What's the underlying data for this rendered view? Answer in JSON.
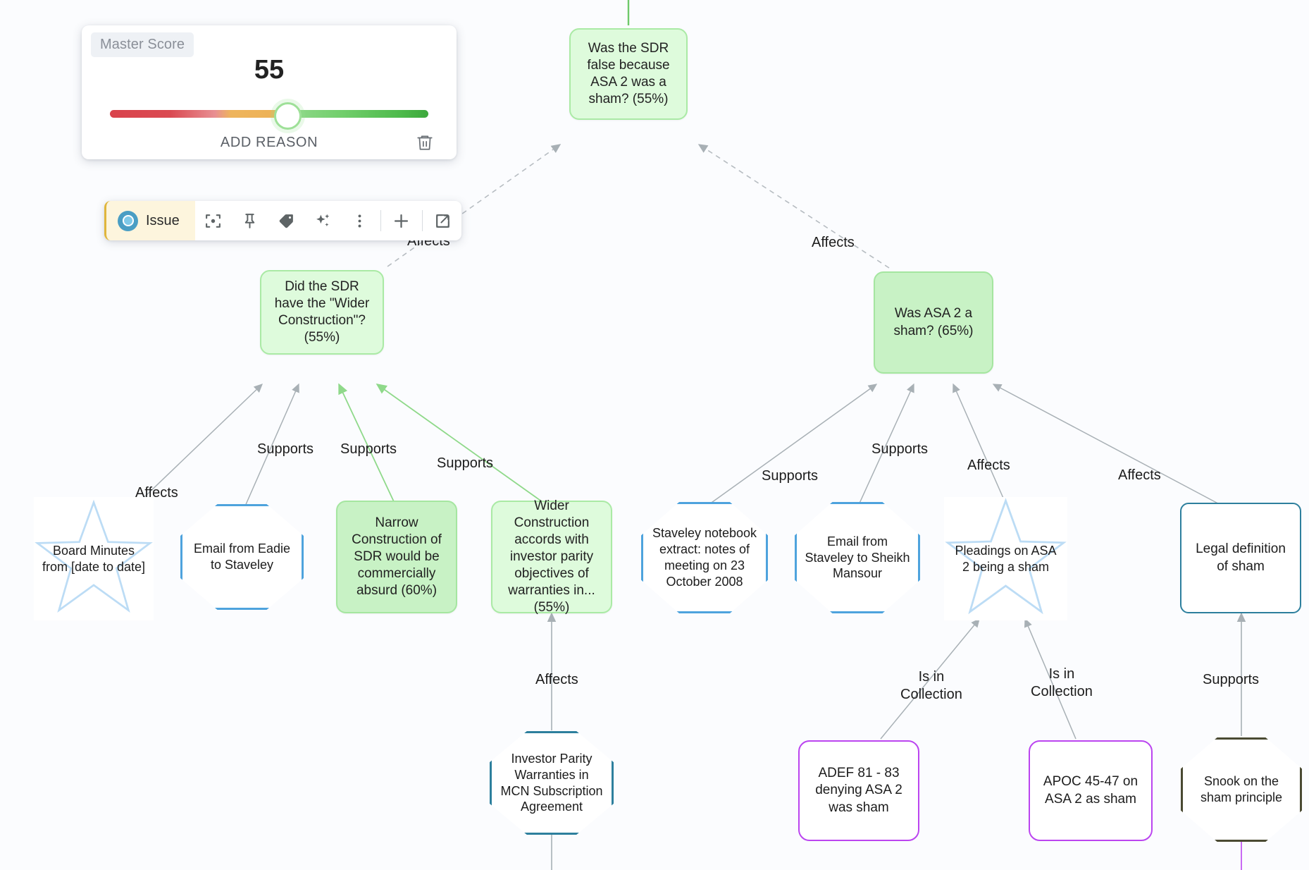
{
  "score_panel": {
    "chip_label": "Master Score",
    "value": "55",
    "add_reason_label": "ADD REASON",
    "slider_percent": 55,
    "trash_icon": "trash-icon",
    "colors": {
      "low": "#d9434c",
      "mid": "#eeb45c",
      "high": "#3da83c",
      "thumb_ring": "#9ee098"
    }
  },
  "toolbar": {
    "type_label": "Issue",
    "buttons": [
      {
        "name": "focus-target-icon",
        "title": "focus"
      },
      {
        "name": "pin-icon",
        "title": "pin"
      },
      {
        "name": "tag-icon",
        "title": "tag"
      },
      {
        "name": "sparkles-icon",
        "title": "ai"
      },
      {
        "name": "more-options-icon",
        "title": "more"
      },
      {
        "name": "plus-icon",
        "title": "add"
      },
      {
        "name": "open-external-icon",
        "title": "open"
      }
    ]
  },
  "graph": {
    "nodes": [
      {
        "id": "n1",
        "label": "Was the SDR false because ASA 2 was a sham? (55%)",
        "shape": "rounded-rect",
        "kind": "issue",
        "score": "55%"
      },
      {
        "id": "n2",
        "label": "Did the SDR have the \"Wider Construction\"? (55%)",
        "shape": "rounded-rect",
        "kind": "issue",
        "score": "55%"
      },
      {
        "id": "n3",
        "label": "Was ASA 2 a sham? (65%)",
        "shape": "rounded-rect",
        "kind": "issue",
        "score": "65%"
      },
      {
        "id": "n4",
        "label": "Board Minutes from [date to date]",
        "shape": "star",
        "kind": "collection"
      },
      {
        "id": "n5",
        "label": "Email from Eadie to Staveley",
        "shape": "octagon",
        "kind": "evidence"
      },
      {
        "id": "n6",
        "label": "Narrow Construction of SDR would be commercially absurd (60%)",
        "shape": "rounded-rect",
        "kind": "claim",
        "score": "60%"
      },
      {
        "id": "n7",
        "label": "Wider Construction accords with investor parity objectives of warranties in... (55%)",
        "shape": "rounded-rect",
        "kind": "claim",
        "score": "55%"
      },
      {
        "id": "n8",
        "label": "Staveley notebook extract: notes of meeting on 23 October 2008",
        "shape": "octagon",
        "kind": "evidence"
      },
      {
        "id": "n9",
        "label": "Email from Staveley to Sheikh Mansour",
        "shape": "octagon",
        "kind": "evidence"
      },
      {
        "id": "n10",
        "label": "Pleadings on ASA 2 being a sham",
        "shape": "star",
        "kind": "collection"
      },
      {
        "id": "n11",
        "label": "Legal definition of sham",
        "shape": "rounded-rect",
        "kind": "authority"
      },
      {
        "id": "n12",
        "label": "Investor Parity Warranties in MCN Subscription Agreement",
        "shape": "octagon",
        "kind": "evidence"
      },
      {
        "id": "n13",
        "label": "ADEF 81 - 83 denying ASA 2 was sham",
        "shape": "rounded-rect",
        "kind": "pleading"
      },
      {
        "id": "n14",
        "label": "APOC 45-47 on ASA 2 as sham",
        "shape": "rounded-rect",
        "kind": "pleading"
      },
      {
        "id": "n15",
        "label": "Snook on the sham principle",
        "shape": "octagon",
        "kind": "authority"
      }
    ],
    "edge_labels": [
      {
        "id": "e1",
        "text": "Affects"
      },
      {
        "id": "e2",
        "text": "Affects"
      },
      {
        "id": "e3",
        "text": "Affects"
      },
      {
        "id": "e4",
        "text": "Supports"
      },
      {
        "id": "e5",
        "text": "Supports"
      },
      {
        "id": "e6",
        "text": "Supports"
      },
      {
        "id": "e7",
        "text": "Supports"
      },
      {
        "id": "e8",
        "text": "Supports"
      },
      {
        "id": "e9",
        "text": "Affects"
      },
      {
        "id": "e10",
        "text": "Affects"
      },
      {
        "id": "e11",
        "text": "Affects"
      },
      {
        "id": "e12",
        "text": "Is in\nCollection"
      },
      {
        "id": "e13",
        "text": "Is in\nCollection"
      },
      {
        "id": "e14",
        "text": "Supports"
      }
    ]
  }
}
